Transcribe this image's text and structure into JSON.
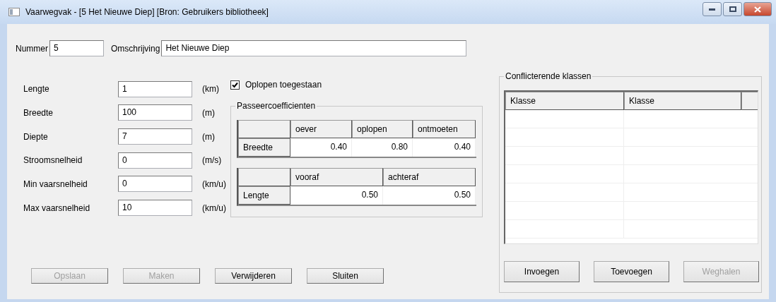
{
  "window": {
    "title": "Vaarwegvak - [5 Het Nieuwe Diep] [Bron: Gebruikers bibliotheek]"
  },
  "header": [
    {
      "label": "Nummer",
      "value": "5",
      "kind": "short"
    },
    {
      "label": "Omschrijving",
      "value": "Het Nieuwe Diep",
      "kind": "long"
    }
  ],
  "fields": [
    {
      "label": "Lengte",
      "value": "1",
      "unit": "(km)"
    },
    {
      "label": "Breedte",
      "value": "100",
      "unit": "(m)"
    },
    {
      "label": "Diepte",
      "value": "7",
      "unit": "(m)"
    },
    {
      "label": "Stroomsnelheid",
      "value": "0",
      "unit": "(m/s)"
    },
    {
      "label": "Min vaarsnelheid",
      "value": "0",
      "unit": "(km/u)"
    },
    {
      "label": "Max vaarsnelheid",
      "value": "10",
      "unit": "(km/u)"
    }
  ],
  "oplopen": {
    "label": "Oplopen toegestaan",
    "checked": true
  },
  "passeercoefficienten": {
    "title": "Passeercoefficienten",
    "tables": [
      {
        "columns": [
          "oever",
          "oplopen",
          "ontmoeten"
        ],
        "row_label": "Breedte",
        "values": [
          "0.40",
          "0.80",
          "0.40"
        ]
      },
      {
        "columns": [
          "vooraf",
          "achteraf"
        ],
        "row_label": "Lengte",
        "values": [
          "0.50",
          "0.50"
        ]
      }
    ]
  },
  "conflicterende_klassen": {
    "title": "Conflicterende klassen",
    "columns": [
      "Klasse",
      "Klasse"
    ],
    "buttons": [
      {
        "label": "Invoegen",
        "disabled": false
      },
      {
        "label": "Toevoegen",
        "disabled": false
      },
      {
        "label": "Weghalen",
        "disabled": true
      }
    ]
  },
  "buttons": [
    {
      "label": "Opslaan",
      "disabled": true
    },
    {
      "label": "Maken",
      "disabled": true
    },
    {
      "label": "Verwijderen",
      "disabled": false
    },
    {
      "label": "Sluiten",
      "disabled": false
    }
  ]
}
